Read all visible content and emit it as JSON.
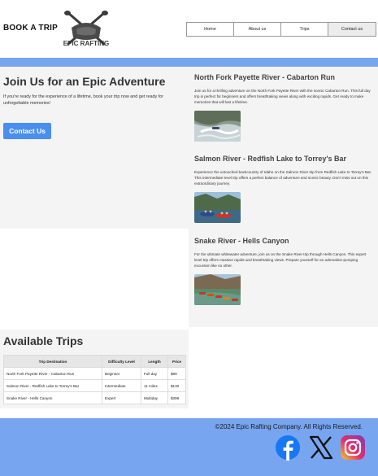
{
  "header": {
    "book_button": "BOOK A TRIP",
    "logo_text": "EPIC RAFTING",
    "nav": [
      {
        "label": "Home"
      },
      {
        "label": "About us"
      },
      {
        "label": "Trips"
      },
      {
        "label": "Contact us"
      }
    ]
  },
  "intro": {
    "title": "Join Us for an Epic Adventure",
    "text": "If you're ready for the experience of a lifetime, book your trip now and get ready for unforgettable memories!",
    "button": "Contact Us"
  },
  "trips": [
    {
      "title": "North Fork Payette River - Cabarton Run",
      "description": "Join us for a thrilling adventure on the North Fork Payette River with the scenic Cabarton Run. This full day trip is perfect for beginners and offers breathtaking views along with exciting rapids. Get ready to make memories that will last a lifetime."
    },
    {
      "title": "Salmon River - Redfish Lake to Torrey's Bar",
      "description": "Experience the untouched backcountry of Idaho on the Salmon River trip from Redfish Lake to Torrey's Bar. This intermediate level trip offers a perfect balance of adventure and scenic beauty. Don't miss out on this extraordinary journey."
    },
    {
      "title": "Snake River - Hells Canyon",
      "description": "For the ultimate whitewater adventure, join us on the Snake River trip through Hells Canyon. This expert level trip offers massive rapids and breathtaking views. Prepare yourself for an adrenaline-pumping excursion like no other."
    }
  ],
  "available": {
    "title": "Available Trips",
    "headers": [
      "Trip Destination",
      "Difficulty Level",
      "Length",
      "Price"
    ],
    "rows": [
      [
        "North Fork Payette River - Cabarton Run",
        "Beginner",
        "Full day",
        "$99"
      ],
      [
        "Salmon River - Redfish Lake to Torrey's Bar",
        "Intermediate",
        "11 miles",
        "$130"
      ],
      [
        "Snake River - Hells Canyon",
        "Expert",
        "Multiday",
        "$399"
      ]
    ]
  },
  "footer": {
    "copyright": "©2024 Epic Rafting Company. All Rights Reserved.",
    "social": [
      "facebook-icon",
      "x-icon",
      "instagram-icon"
    ]
  },
  "colors": {
    "band_blue": "#78a5f0",
    "button_blue": "#4a8ef0",
    "panel_gray": "#f4f4f4"
  }
}
